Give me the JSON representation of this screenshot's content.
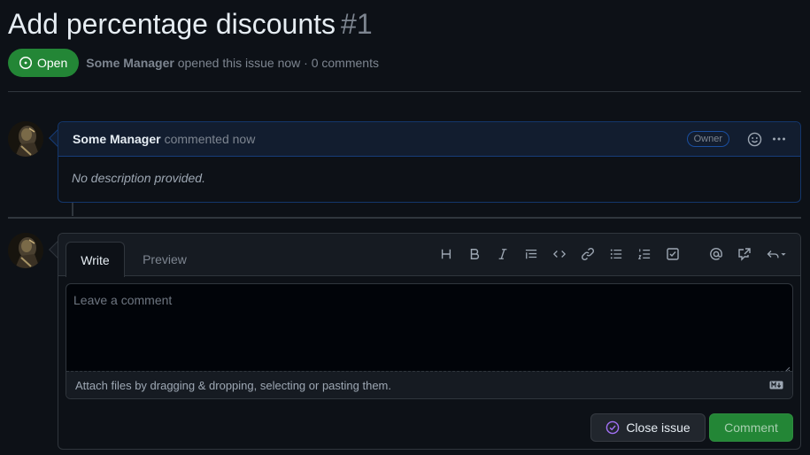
{
  "issue": {
    "title": "Add percentage discounts",
    "number": "#1",
    "state": "Open",
    "author": "Some Manager",
    "opened_text": "opened this issue now · 0 comments"
  },
  "comment": {
    "author": "Some Manager",
    "action": "commented now",
    "badge": "Owner",
    "body": "No description provided."
  },
  "editor": {
    "tabs": [
      {
        "label": "Write",
        "active": true
      },
      {
        "label": "Preview",
        "active": false
      }
    ],
    "toolbar_icons": [
      "heading-icon",
      "bold-icon",
      "italic-icon",
      "quote-icon",
      "code-icon",
      "link-icon",
      "unordered-list-icon",
      "ordered-list-icon",
      "task-list-icon",
      "mention-icon",
      "cross-reference-icon",
      "saved-reply-icon"
    ],
    "placeholder": "Leave a comment",
    "attach_text": "Attach files by dragging & dropping, selecting or pasting them.",
    "close_button": "Close issue",
    "submit_button": "Comment"
  },
  "colors": {
    "background": "#0d1117",
    "open_green": "#238636",
    "accent_blue": "#1f6feb",
    "close_purple": "#a371f7"
  }
}
